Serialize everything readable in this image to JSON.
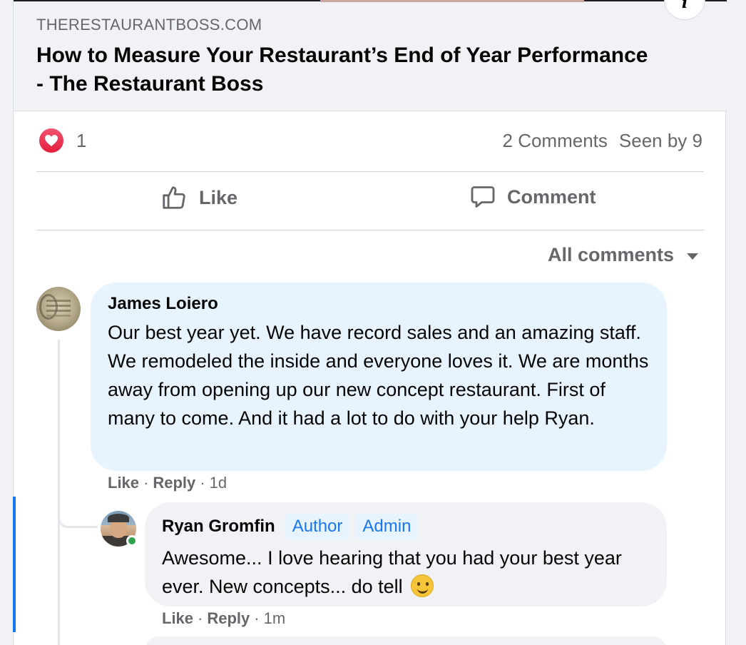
{
  "link_preview": {
    "domain": "THERESTAURANTBOSS.COM",
    "title": "How to Measure Your Restaurant’s End of Year Performance - The Restaurant Boss",
    "info_icon": "info-icon"
  },
  "reactions": {
    "icon": "heart-icon",
    "count": "1"
  },
  "stats": {
    "comments": "2 Comments",
    "seen_by": "Seen by 9"
  },
  "actions": {
    "like": "Like",
    "comment": "Comment"
  },
  "sort": {
    "label": "All comments"
  },
  "comments": [
    {
      "author": "James Loiero",
      "text": "Our best year yet. We have record sales and an amazing staff. We remodeled the inside and everyone loves it. We are months away from opening up our new concept restaurant. First of many to come. And it had a lot to do with your help Ryan.",
      "like": "Like",
      "reply": "Reply",
      "time": "1d"
    },
    {
      "author": "Ryan Gromfin",
      "badges": [
        "Author",
        "Admin"
      ],
      "text": "Awesome... I love hearing that you had your best year ever. New concepts... do tell",
      "emoji": "slightly-smiling-face",
      "like": "Like",
      "reply": "Reply",
      "time": "1m",
      "online": true
    }
  ],
  "colors": {
    "accent": "#1877f2",
    "secondary_text": "#65676b",
    "highlight_bubble": "#e7f3ff",
    "reply_bubble": "#f0f2f5",
    "online": "#31a24c",
    "heart": "#e41e3f"
  }
}
